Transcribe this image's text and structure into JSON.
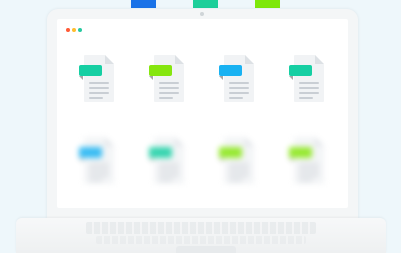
{
  "top_swatches": [
    {
      "name": "blue",
      "color": "#1a73e8"
    },
    {
      "name": "teal",
      "color": "#1ccf9a"
    },
    {
      "name": "lime",
      "color": "#7ee80a"
    }
  ],
  "window_controls": {
    "colors": [
      "#ff5a36",
      "#ffbd2e",
      "#27c9a0"
    ]
  },
  "file_icons": [
    {
      "name": "file-icon-teal",
      "tag_color": "#16cfa3",
      "state": "sharp"
    },
    {
      "name": "file-icon-lime",
      "tag_color": "#86e60f",
      "state": "sharp"
    },
    {
      "name": "file-icon-blue",
      "tag_color": "#19b2f2",
      "state": "sharp"
    },
    {
      "name": "file-icon-teal",
      "tag_color": "#16cfa3",
      "state": "sharp"
    },
    {
      "name": "file-icon-blue",
      "tag_color": "#19b2f2",
      "state": "blurred"
    },
    {
      "name": "file-icon-teal",
      "tag_color": "#16cfa3",
      "state": "blurred"
    },
    {
      "name": "file-icon-lime",
      "tag_color": "#86e60f",
      "state": "blurred"
    },
    {
      "name": "file-icon-lime",
      "tag_color": "#86e60f",
      "state": "blurred"
    }
  ]
}
